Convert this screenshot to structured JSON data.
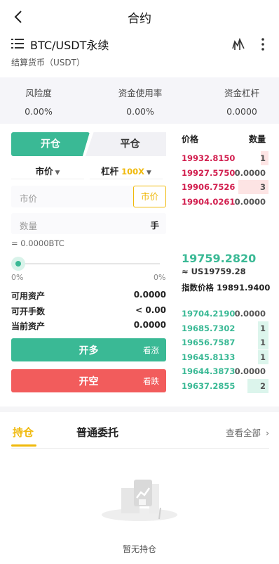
{
  "header": {
    "title": "合约"
  },
  "pair": {
    "name": "BTC/USDT永续",
    "settle": "结算货币（USDT）"
  },
  "stats": [
    {
      "label": "风险度",
      "value": "0.00%"
    },
    {
      "label": "资金使用率",
      "value": "0.00%"
    },
    {
      "label": "资金杠杆",
      "value": "0.0000"
    }
  ],
  "trade": {
    "tab_open": "开仓",
    "tab_close": "平仓",
    "order_type": "市价",
    "leverage_label": "杠杆",
    "leverage_value": "100X",
    "price_placeholder": "市价",
    "price_button": "市价",
    "qty_placeholder": "数量",
    "qty_unit": "手",
    "equals": "= 0.0000BTC",
    "slider_min": "0%",
    "slider_max": "0%",
    "slider_value": 0,
    "available_label": "可用资产",
    "available_value": "0.0000",
    "openable_label": "可开手数",
    "openable_value": "< 0.00",
    "current_label": "当前资产",
    "current_value": "0.0000",
    "long_label": "开多",
    "long_sub": "看涨",
    "short_label": "开空",
    "short_sub": "看跌"
  },
  "orderbook": {
    "price_header": "价格",
    "qty_header": "数量",
    "asks": [
      {
        "price": "19932.8150",
        "qty": "1",
        "depth": 0.25
      },
      {
        "price": "19927.5750",
        "qty": "0.0000",
        "depth": 0
      },
      {
        "price": "19906.7526",
        "qty": "3",
        "depth": 1.0
      },
      {
        "price": "19904.0261",
        "qty": "0.0000",
        "depth": 0
      }
    ],
    "last_price": "19759.2820",
    "usd_price": "≈ US19759.28",
    "index_label": "指数价格",
    "index_value": "19891.9400",
    "bids": [
      {
        "price": "19704.2190",
        "qty": "0.0000",
        "depth": 0
      },
      {
        "price": "19685.7302",
        "qty": "1",
        "depth": 0.35
      },
      {
        "price": "19656.7587",
        "qty": "1",
        "depth": 0.35
      },
      {
        "price": "19645.8133",
        "qty": "1",
        "depth": 0.35
      },
      {
        "price": "19644.3873",
        "qty": "0.0000",
        "depth": 0
      },
      {
        "price": "19637.2855",
        "qty": "2",
        "depth": 0.7
      }
    ]
  },
  "positions": {
    "tab_positions": "持仓",
    "tab_orders": "普通委托",
    "view_all": "查看全部",
    "empty_text": "暂无持仓"
  },
  "colors": {
    "green": "#3ab995",
    "red": "#f25c5c",
    "gold": "#f0b90b",
    "ask": "#d21f4f"
  }
}
